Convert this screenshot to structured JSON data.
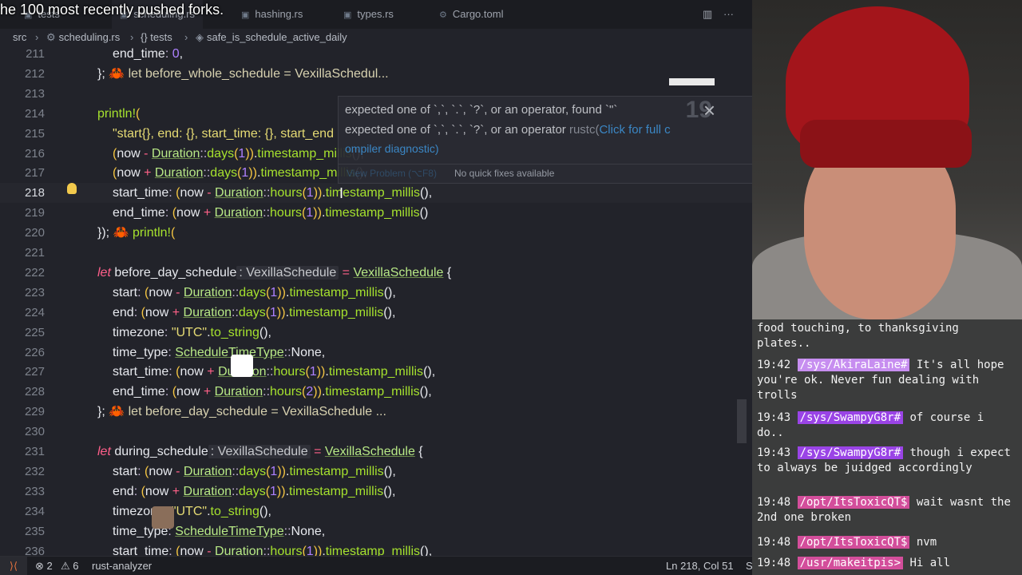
{
  "overlay_title": "he 100 most recently pushed forks.",
  "tabs": [
    {
      "label": "tests",
      "icon": "rust-file-icon"
    },
    {
      "label": "scheduling.rs",
      "icon": "rust-file-icon"
    },
    {
      "label": "hashing.rs",
      "icon": "rust-file-icon"
    },
    {
      "label": "types.rs",
      "icon": "rust-file-icon"
    },
    {
      "label": "Cargo.toml",
      "icon": "gear-icon"
    }
  ],
  "breadcrumbs": [
    "src",
    "scheduling.rs",
    "{} tests",
    "safe_is_schedule_active_daily"
  ],
  "code": {
    "lines": [
      {
        "n": "211",
        "indent": 2,
        "parts": [
          [
            "t",
            "end_time"
          ],
          [
            "o",
            ": "
          ],
          [
            "num",
            "0"
          ],
          [
            "t",
            ","
          ]
        ]
      },
      {
        "n": "212",
        "indent": 1,
        "parts": [
          [
            "t",
            "};"
          ],
          [
            "crab",
            " 🦀 "
          ],
          [
            "inl",
            "let before_whole_schedule = VexillaSchedul..."
          ]
        ]
      },
      {
        "n": "213",
        "indent": 1,
        "parts": []
      },
      {
        "n": "214",
        "indent": 1,
        "parts": [
          [
            "mac",
            "println!"
          ],
          [
            "par",
            "("
          ]
        ]
      },
      {
        "n": "215",
        "indent": 2,
        "parts": [
          [
            "str",
            "\"start{}, end: {}, start_time: {}, start_end"
          ]
        ]
      },
      {
        "n": "216",
        "indent": 2,
        "parts": [
          [
            "par",
            "("
          ],
          [
            "t",
            "now "
          ],
          [
            "op",
            "- "
          ],
          [
            "ty",
            "Duration"
          ],
          [
            "o",
            "::"
          ],
          [
            "fn",
            "days"
          ],
          [
            "par",
            "("
          ],
          [
            "num",
            "1"
          ],
          [
            "par",
            ")"
          ],
          [
            "par",
            ")"
          ],
          [
            "t",
            "."
          ],
          [
            "fn",
            "timestamp_millis"
          ],
          [
            "t",
            "(),"
          ]
        ]
      },
      {
        "n": "217",
        "indent": 2,
        "parts": [
          [
            "par",
            "("
          ],
          [
            "t",
            "now "
          ],
          [
            "op",
            "+ "
          ],
          [
            "ty",
            "Duration"
          ],
          [
            "o",
            "::"
          ],
          [
            "fn",
            "days"
          ],
          [
            "par",
            "("
          ],
          [
            "num",
            "1"
          ],
          [
            "par",
            ")"
          ],
          [
            "par",
            ")"
          ],
          [
            "t",
            "."
          ],
          [
            "fn",
            "timestamp_millis"
          ],
          [
            "t",
            "(),"
          ]
        ]
      },
      {
        "n": "218",
        "indent": 2,
        "cur": true,
        "parts": [
          [
            "t",
            "start_time"
          ],
          [
            "o",
            ": "
          ],
          [
            "par",
            "("
          ],
          [
            "t",
            "now "
          ],
          [
            "op",
            "- "
          ],
          [
            "ty",
            "Duration"
          ],
          [
            "o",
            "::"
          ],
          [
            "fn",
            "hours"
          ],
          [
            "par",
            "("
          ],
          [
            "num",
            "1"
          ],
          [
            "par",
            ")"
          ],
          [
            "par",
            ")"
          ],
          [
            "t",
            "."
          ],
          [
            "fn",
            "timestamp_millis"
          ],
          [
            "t",
            "(),"
          ]
        ]
      },
      {
        "n": "219",
        "indent": 2,
        "parts": [
          [
            "t",
            "end_time"
          ],
          [
            "o",
            ": "
          ],
          [
            "par",
            "("
          ],
          [
            "t",
            "now "
          ],
          [
            "op",
            "+ "
          ],
          [
            "ty",
            "Duration"
          ],
          [
            "o",
            "::"
          ],
          [
            "fn",
            "hours"
          ],
          [
            "par",
            "("
          ],
          [
            "num",
            "1"
          ],
          [
            "par",
            ")"
          ],
          [
            "par",
            ")"
          ],
          [
            "t",
            "."
          ],
          [
            "fn",
            "timestamp_millis"
          ],
          [
            "t",
            "()"
          ]
        ]
      },
      {
        "n": "220",
        "indent": 1,
        "parts": [
          [
            "t",
            "});"
          ],
          [
            "crab",
            " 🦀 "
          ],
          [
            "fn",
            "println!"
          ],
          [
            "par",
            "("
          ]
        ]
      },
      {
        "n": "221",
        "indent": 1,
        "parts": []
      },
      {
        "n": "222",
        "indent": 1,
        "parts": [
          [
            "kw",
            "let "
          ],
          [
            "t",
            "before_day_schedule"
          ],
          [
            "hint",
            ": VexillaSchedule"
          ],
          [
            "t",
            " "
          ],
          [
            "op",
            "= "
          ],
          [
            "ty",
            "VexillaSchedule"
          ],
          [
            "t",
            " {"
          ]
        ]
      },
      {
        "n": "223",
        "indent": 2,
        "parts": [
          [
            "t",
            "start"
          ],
          [
            "o",
            ": "
          ],
          [
            "par",
            "("
          ],
          [
            "t",
            "now "
          ],
          [
            "op",
            "- "
          ],
          [
            "ty",
            "Duration"
          ],
          [
            "o",
            "::"
          ],
          [
            "fn",
            "days"
          ],
          [
            "par",
            "("
          ],
          [
            "num",
            "1"
          ],
          [
            "par",
            ")"
          ],
          [
            "par",
            ")"
          ],
          [
            "t",
            "."
          ],
          [
            "fn",
            "timestamp_millis"
          ],
          [
            "t",
            "(),"
          ]
        ]
      },
      {
        "n": "224",
        "indent": 2,
        "parts": [
          [
            "t",
            "end"
          ],
          [
            "o",
            ": "
          ],
          [
            "par",
            "("
          ],
          [
            "t",
            "now "
          ],
          [
            "op",
            "+ "
          ],
          [
            "ty",
            "Duration"
          ],
          [
            "o",
            "::"
          ],
          [
            "fn",
            "days"
          ],
          [
            "par",
            "("
          ],
          [
            "num",
            "1"
          ],
          [
            "par",
            ")"
          ],
          [
            "par",
            ")"
          ],
          [
            "t",
            "."
          ],
          [
            "fn",
            "timestamp_millis"
          ],
          [
            "t",
            "(),"
          ]
        ]
      },
      {
        "n": "225",
        "indent": 2,
        "parts": [
          [
            "t",
            "timezone"
          ],
          [
            "o",
            ": "
          ],
          [
            "str",
            "\"UTC\""
          ],
          [
            "t",
            "."
          ],
          [
            "fn",
            "to_string"
          ],
          [
            "t",
            "(),"
          ]
        ]
      },
      {
        "n": "226",
        "indent": 2,
        "parts": [
          [
            "t",
            "time_type"
          ],
          [
            "o",
            ": "
          ],
          [
            "ty",
            "ScheduleTimeType"
          ],
          [
            "o",
            "::"
          ],
          [
            "t",
            "None,"
          ]
        ]
      },
      {
        "n": "227",
        "indent": 2,
        "parts": [
          [
            "t",
            "start_time"
          ],
          [
            "o",
            ": "
          ],
          [
            "par",
            "("
          ],
          [
            "t",
            "now "
          ],
          [
            "op",
            "+ "
          ],
          [
            "ty",
            "Duration"
          ],
          [
            "o",
            "::"
          ],
          [
            "fn",
            "hours"
          ],
          [
            "par",
            "("
          ],
          [
            "num",
            "1"
          ],
          [
            "par",
            ")"
          ],
          [
            "par",
            ")"
          ],
          [
            "t",
            "."
          ],
          [
            "fn",
            "timestamp_millis"
          ],
          [
            "t",
            "(),"
          ]
        ]
      },
      {
        "n": "228",
        "indent": 2,
        "parts": [
          [
            "t",
            "end_time"
          ],
          [
            "o",
            ": "
          ],
          [
            "par",
            "("
          ],
          [
            "t",
            "now "
          ],
          [
            "op",
            "+ "
          ],
          [
            "ty",
            "Duration"
          ],
          [
            "o",
            "::"
          ],
          [
            "fn",
            "hours"
          ],
          [
            "par",
            "("
          ],
          [
            "num",
            "2"
          ],
          [
            "par",
            ")"
          ],
          [
            "par",
            ")"
          ],
          [
            "t",
            "."
          ],
          [
            "fn",
            "timestamp_millis"
          ],
          [
            "t",
            "(),"
          ]
        ]
      },
      {
        "n": "229",
        "indent": 1,
        "parts": [
          [
            "t",
            "};"
          ],
          [
            "crab",
            " 🦀 "
          ],
          [
            "inl",
            "let before_day_schedule = VexillaSchedule ..."
          ]
        ]
      },
      {
        "n": "230",
        "indent": 1,
        "parts": []
      },
      {
        "n": "231",
        "indent": 1,
        "parts": [
          [
            "kw",
            "let "
          ],
          [
            "t",
            "during_schedule"
          ],
          [
            "hint",
            ": VexillaSchedule"
          ],
          [
            "t",
            " "
          ],
          [
            "op",
            "= "
          ],
          [
            "ty",
            "VexillaSchedule"
          ],
          [
            "t",
            " {"
          ]
        ]
      },
      {
        "n": "232",
        "indent": 2,
        "parts": [
          [
            "t",
            "start"
          ],
          [
            "o",
            ": "
          ],
          [
            "par",
            "("
          ],
          [
            "t",
            "now "
          ],
          [
            "op",
            "- "
          ],
          [
            "ty",
            "Duration"
          ],
          [
            "o",
            "::"
          ],
          [
            "fn",
            "days"
          ],
          [
            "par",
            "("
          ],
          [
            "num",
            "1"
          ],
          [
            "par",
            ")"
          ],
          [
            "par",
            ")"
          ],
          [
            "t",
            "."
          ],
          [
            "fn",
            "timestamp_millis"
          ],
          [
            "t",
            "(),"
          ]
        ]
      },
      {
        "n": "233",
        "indent": 2,
        "parts": [
          [
            "t",
            "end"
          ],
          [
            "o",
            ": "
          ],
          [
            "par",
            "("
          ],
          [
            "t",
            "now "
          ],
          [
            "op",
            "+ "
          ],
          [
            "ty",
            "Duration"
          ],
          [
            "o",
            "::"
          ],
          [
            "fn",
            "days"
          ],
          [
            "par",
            "("
          ],
          [
            "num",
            "1"
          ],
          [
            "par",
            ")"
          ],
          [
            "par",
            ")"
          ],
          [
            "t",
            "."
          ],
          [
            "fn",
            "timestamp_millis"
          ],
          [
            "t",
            "(),"
          ]
        ]
      },
      {
        "n": "234",
        "indent": 2,
        "parts": [
          [
            "t",
            "timezone"
          ],
          [
            "o",
            ": "
          ],
          [
            "str",
            "\"UTC\""
          ],
          [
            "t",
            "."
          ],
          [
            "fn",
            "to_string"
          ],
          [
            "t",
            "(),"
          ]
        ]
      },
      {
        "n": "235",
        "indent": 2,
        "parts": [
          [
            "t",
            "time_type"
          ],
          [
            "o",
            ": "
          ],
          [
            "ty",
            "ScheduleTimeType"
          ],
          [
            "o",
            "::"
          ],
          [
            "t",
            "None,"
          ]
        ]
      },
      {
        "n": "236",
        "indent": 2,
        "parts": [
          [
            "t",
            "start_time"
          ],
          [
            "o",
            ": "
          ],
          [
            "par",
            "("
          ],
          [
            "t",
            "now "
          ],
          [
            "op",
            "- "
          ],
          [
            "ty",
            "Duration"
          ],
          [
            "o",
            "::"
          ],
          [
            "fn",
            "hours"
          ],
          [
            "par",
            "("
          ],
          [
            "num",
            "1"
          ],
          [
            "par",
            ")"
          ],
          [
            "par",
            ")"
          ],
          [
            "t",
            "."
          ],
          [
            "fn",
            "timestamp_millis"
          ],
          [
            "t",
            "(),"
          ]
        ]
      }
    ]
  },
  "hover": {
    "line1": "expected one of `,`, `.`, `?`, or an operator, found `\"`",
    "line2_prefix": "expected one of `,`, `.`, `?`, or an operator ",
    "line2_source": "rustc(",
    "line2_link": "Click for full c",
    "line3": "ompiler diagnostic)",
    "view_problem": "View Problem (⌥F8)",
    "no_fixes": "No quick fixes available",
    "overlay_number": "19"
  },
  "status": {
    "errors": "2",
    "warnings": "6",
    "language_server": "rust-analyzer",
    "position": "Ln 218, Col 51",
    "extra": "S"
  },
  "chat": [
    {
      "time": "",
      "user": "",
      "text": "food touching, to thanksgiving plates.."
    },
    {
      "time": "19:42",
      "user": "/sys/AkiraLaine#",
      "text": "It's all hope you're ok. Never fun dealing with trolls"
    },
    {
      "time": "19:43",
      "user": "/sys/SwampyG8r#",
      "text": "of course i do.."
    },
    {
      "time": "19:43",
      "user": "/sys/SwampyG8r#",
      "text": "though i expect to always be juidged accordingly"
    },
    {
      "time": "19:48",
      "user": "/opt/ItsToxicQT$",
      "text": "wait wasnt the 2nd one broken"
    },
    {
      "time": "19:48",
      "user": "/opt/ItsToxicQT$",
      "text": "nvm"
    },
    {
      "time": "19:48",
      "user": "/usr/makeitpis>",
      "text": "Hi all"
    }
  ]
}
